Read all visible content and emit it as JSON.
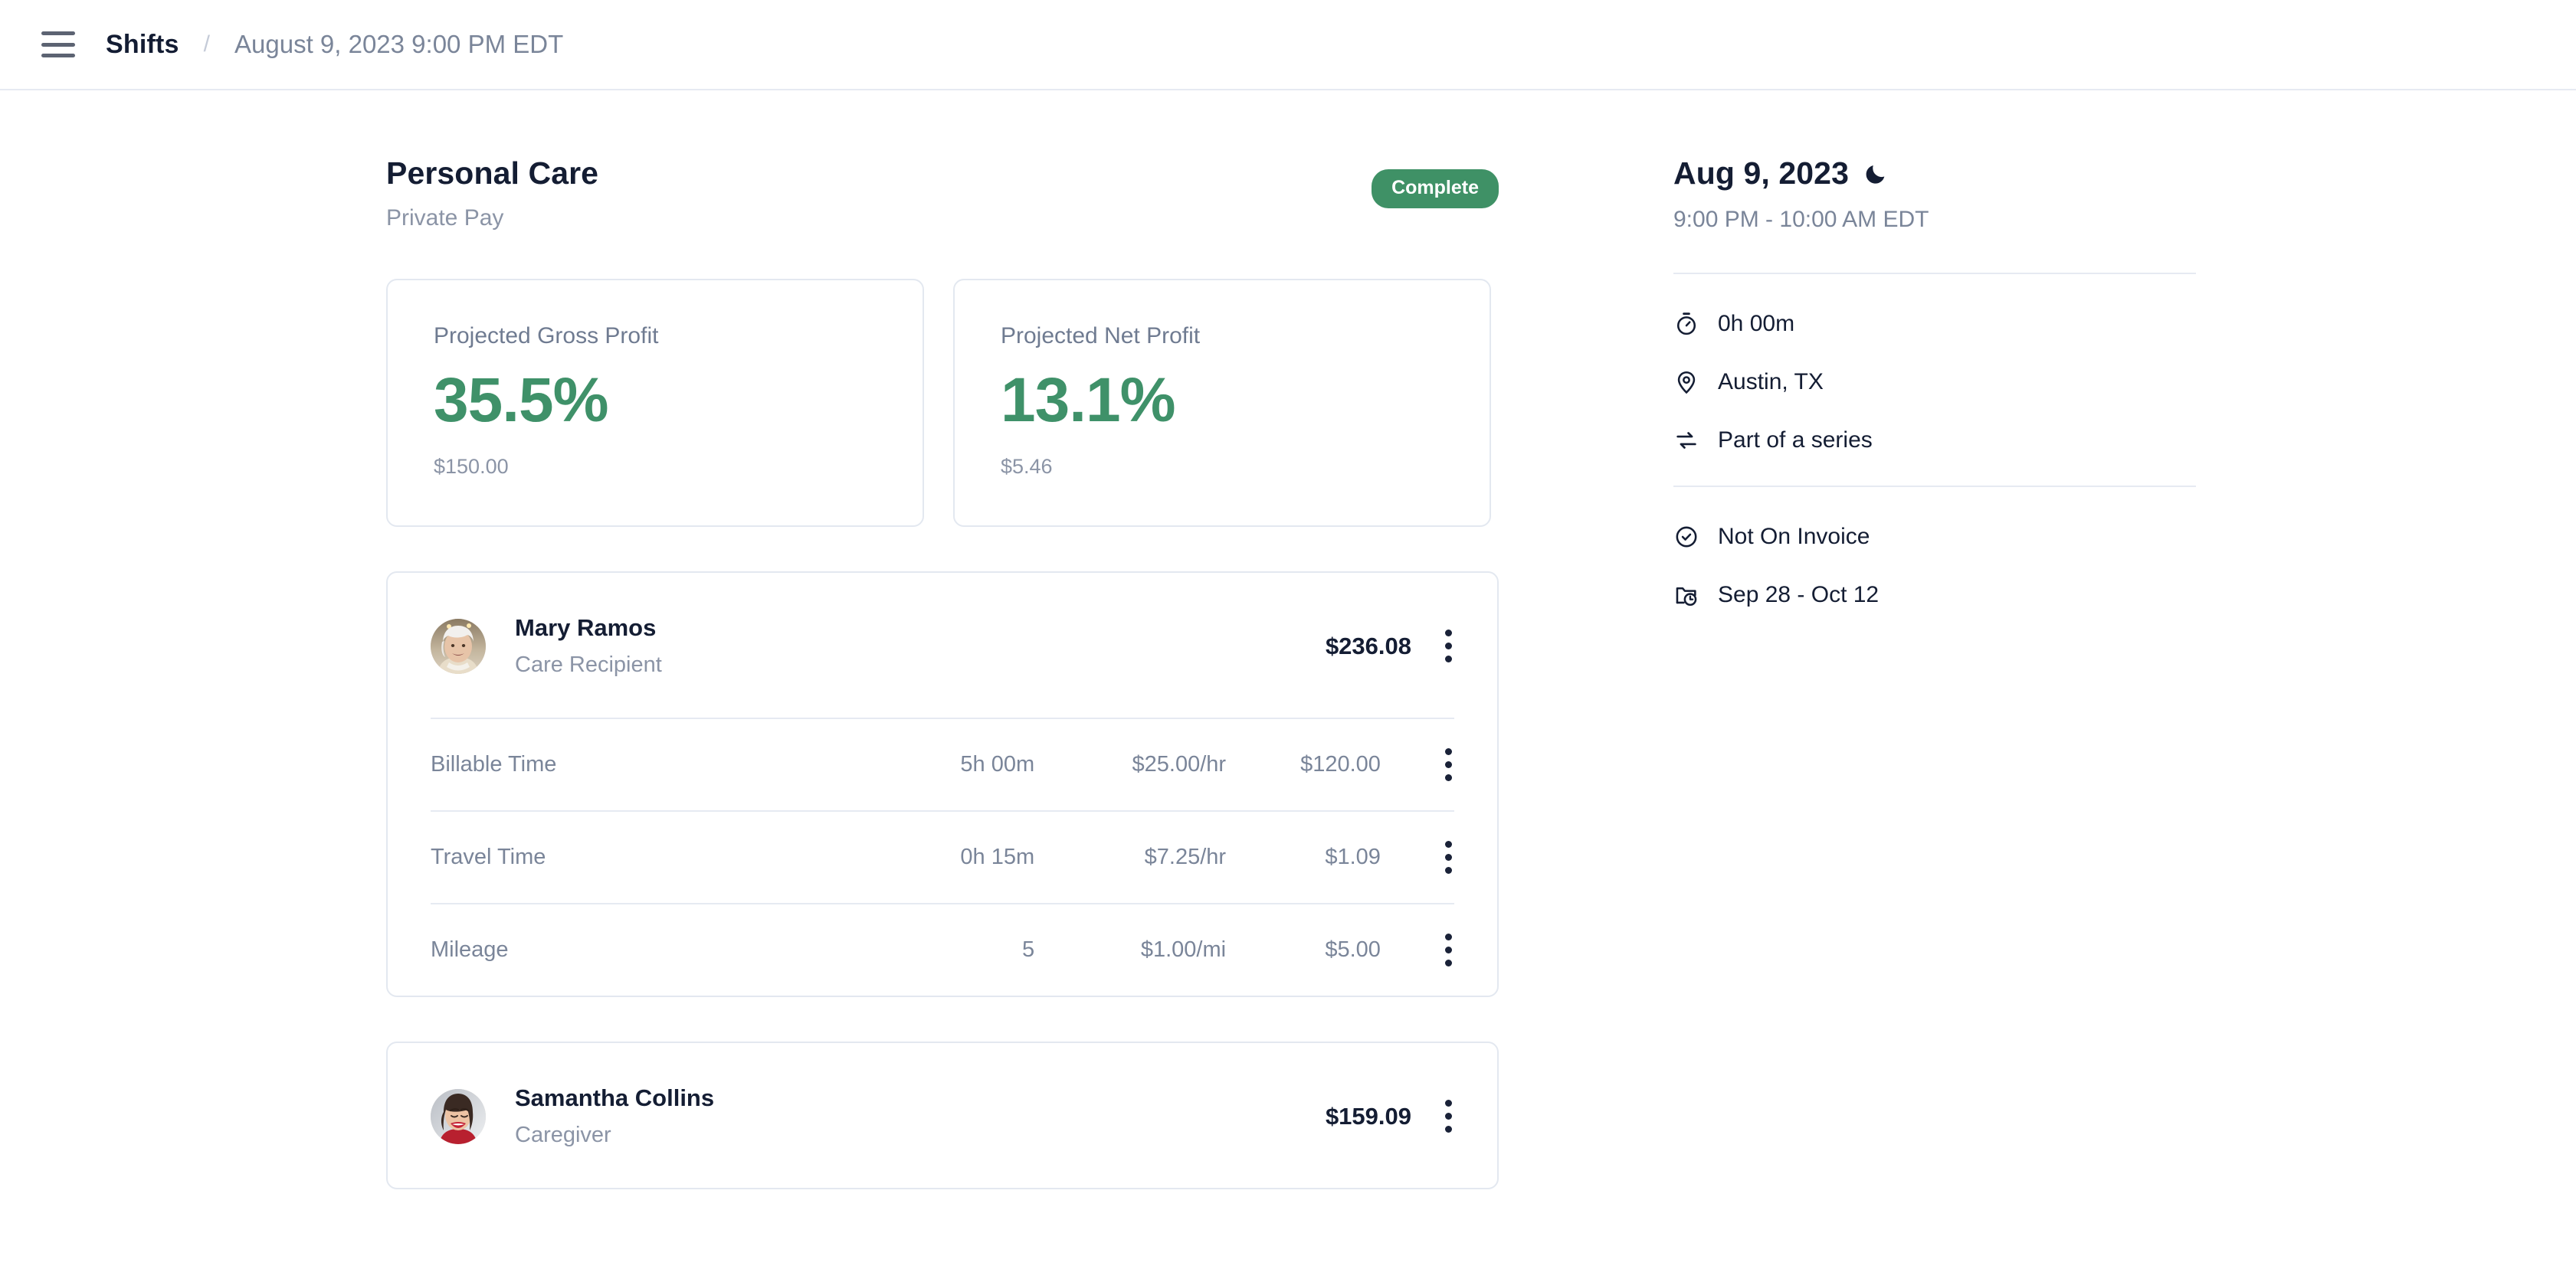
{
  "topbar": {
    "menu_icon": "hamburger-menu-icon",
    "breadcrumb_root": "Shifts",
    "breadcrumb_separator": "/",
    "breadcrumb_current": "August 9, 2023 9:00 PM EDT"
  },
  "header": {
    "title": "Personal Care",
    "subtitle": "Private Pay",
    "status_badge": "Complete",
    "status_color": "#3f9166"
  },
  "profit_cards": [
    {
      "label": "Projected Gross Profit",
      "value": "35.5%",
      "amount": "$150.00",
      "color": "#3f9169"
    },
    {
      "label": "Projected Net Profit",
      "value": "13.1%",
      "amount": "$5.46",
      "color": "#3f9169"
    }
  ],
  "people": [
    {
      "name": "Mary Ramos",
      "role": "Care Recipient",
      "total": "$236.08",
      "avatar": "elderly-woman-avatar",
      "line_items": [
        {
          "label": "Billable Time",
          "quantity": "5h 00m",
          "rate": "$25.00/hr",
          "total": "$120.00"
        },
        {
          "label": "Travel Time",
          "quantity": "0h 15m",
          "rate": "$7.25/hr",
          "total": "$1.09"
        },
        {
          "label": "Mileage",
          "quantity": "5",
          "rate": "$1.00/mi",
          "total": "$5.00"
        }
      ]
    },
    {
      "name": "Samantha Collins",
      "role": "Caregiver",
      "total": "$159.09",
      "avatar": "young-woman-avatar",
      "line_items": []
    }
  ],
  "sidebar": {
    "date": "Aug 9, 2023",
    "date_icon": "moon-icon",
    "time_range": "9:00 PM - 10:00 AM EDT",
    "group_one": [
      {
        "icon": "stopwatch-icon",
        "label": "0h 00m"
      },
      {
        "icon": "location-pin-icon",
        "label": "Austin, TX"
      },
      {
        "icon": "repeat-series-icon",
        "label": "Part of a series"
      }
    ],
    "group_two": [
      {
        "icon": "check-circle-icon",
        "label": "Not On Invoice"
      },
      {
        "icon": "folder-clock-icon",
        "label": "Sep 28 - Oct 12"
      }
    ]
  }
}
